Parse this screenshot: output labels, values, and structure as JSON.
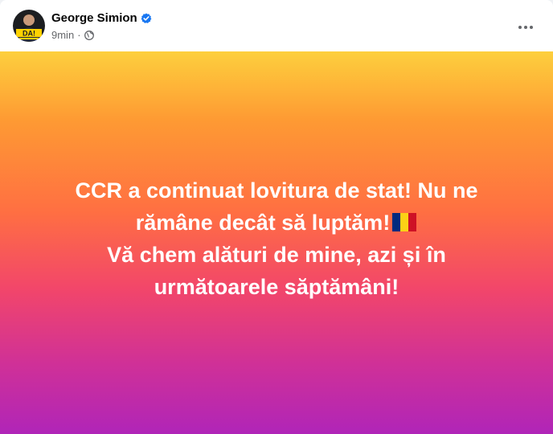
{
  "post": {
    "author": {
      "name": "George Simion",
      "verified": true,
      "avatar_badge_text": "DA!"
    },
    "timestamp": "9min",
    "separator": "·",
    "privacy_icon": "globe-icon",
    "more_icon": "more-options-icon",
    "content": {
      "lines": [
        "CCR a continuat lovitura de stat! Nu ne",
        "rămâne decât să luptăm!",
        "Vă chem alături de mine, azi și în",
        "următoarele săptămâni!"
      ],
      "emoji": "romania-flag",
      "text_color": "#ffffff",
      "background_gradient": [
        "#fdcf3d",
        "#fe9a33",
        "#ff6f42",
        "#f2466a",
        "#cf3098",
        "#b025b8"
      ]
    },
    "colors": {
      "verified_badge": "#1877f2",
      "secondary_text": "#65676b",
      "primary_text": "#050505"
    }
  }
}
